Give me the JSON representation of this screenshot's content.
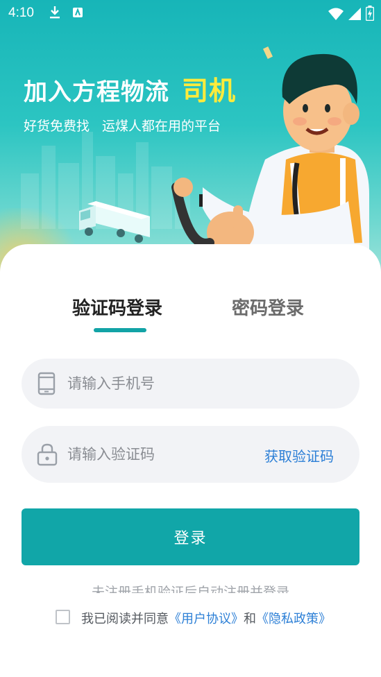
{
  "status_bar": {
    "time": "4:10",
    "icons": [
      "download-icon",
      "apk-icon",
      "wifi-icon",
      "signal-icon",
      "battery-charging-icon"
    ]
  },
  "banner": {
    "title": "加入方程物流",
    "title_accent": "司机",
    "subtitle_left": "好货免费找",
    "subtitle_right": "运煤人都在用的平台"
  },
  "tabs": [
    {
      "label": "验证码登录",
      "active": true
    },
    {
      "label": "密码登录",
      "active": false
    }
  ],
  "phone_field": {
    "placeholder": "请输入手机号",
    "value": "",
    "icon": "phone-icon"
  },
  "code_field": {
    "placeholder": "请输入验证码",
    "value": "",
    "icon": "lock-icon",
    "action_label": "获取验证码"
  },
  "login_button": {
    "label": "登录"
  },
  "hint": "未注册手机验证后自动注册并登录",
  "agreement": {
    "checked": false,
    "prefix": "我已阅读并同意",
    "user_agreement": "《用户协议》",
    "conjunction": "和",
    "privacy_policy": "《隐私政策》"
  },
  "colors": {
    "primary": "#11a6a8",
    "accent_title": "#ffeb3b",
    "link": "#2c7fd6",
    "input_bg": "#f2f3f6"
  }
}
